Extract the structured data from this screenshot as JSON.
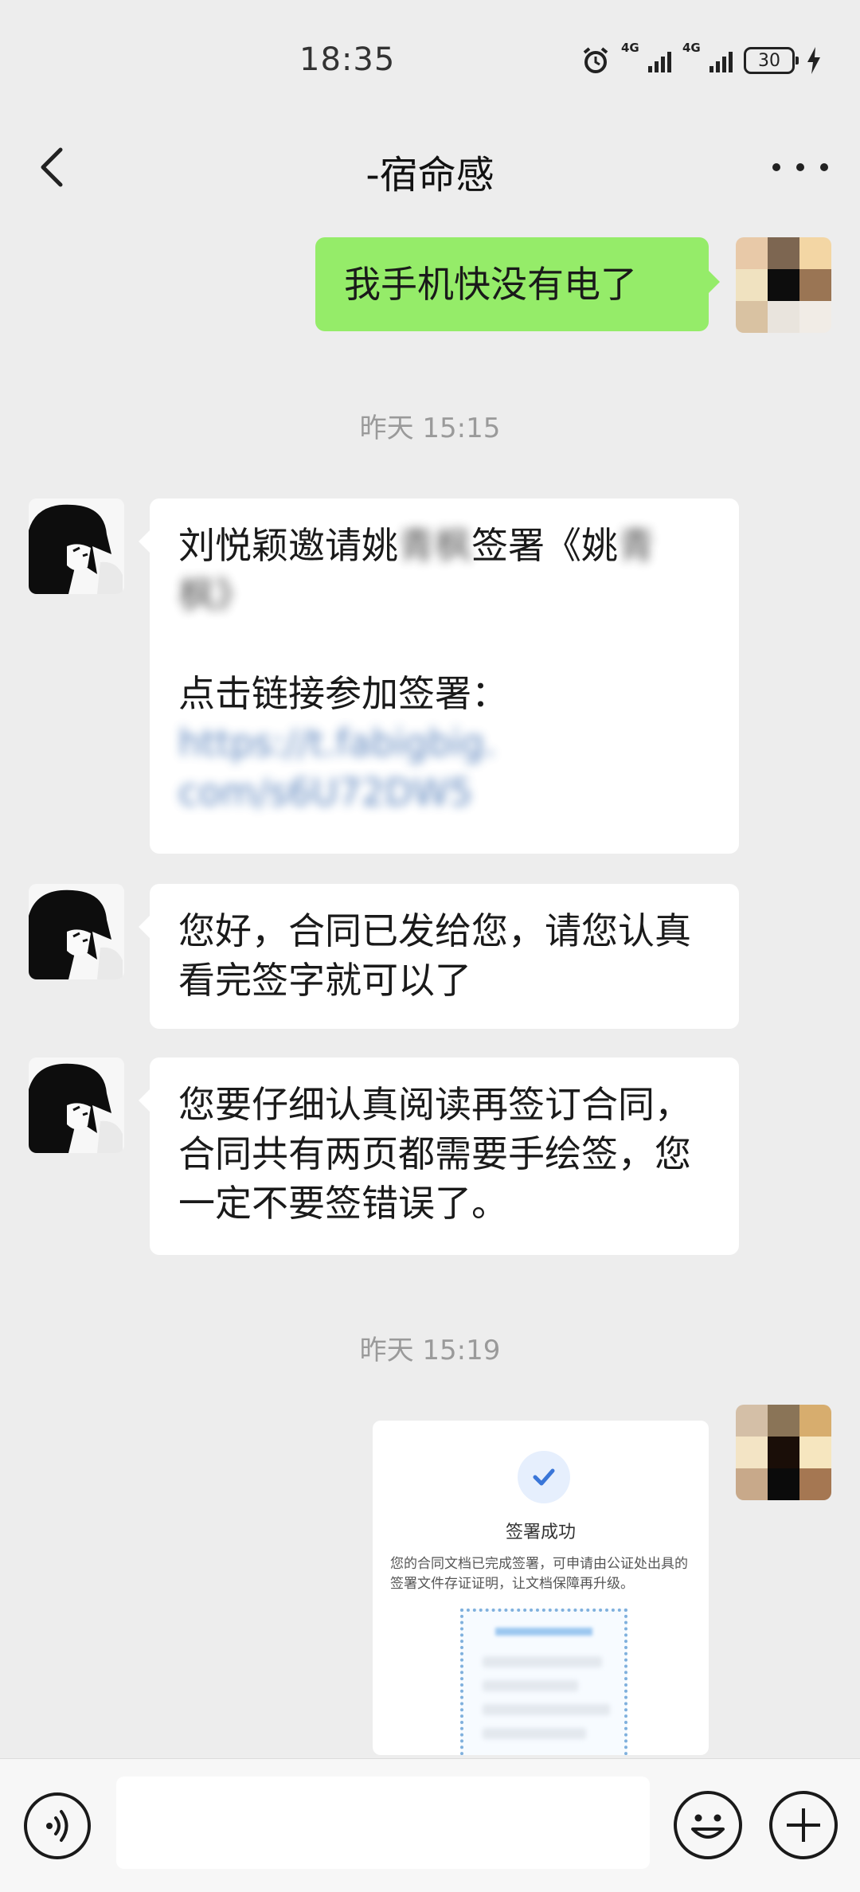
{
  "status_bar": {
    "time": "18:35",
    "network_1": "4G",
    "network_2": "4G",
    "battery": "30"
  },
  "nav": {
    "title": "-宿命感"
  },
  "messages": {
    "m1": {
      "text": "我手机快没有电了"
    },
    "ts1": "昨天 15:15",
    "m2": {
      "line1_visible": "刘悦颖邀请姚",
      "line1_blurred": "青枫",
      "line1_visible2": "签署《姚",
      "line1_blurred2": "青",
      "line2_blurred": "枫》",
      "line3": "点击链接参加签署：",
      "link1": "https://t.fabigbig.",
      "link2": "com/s6U72DW5"
    },
    "m3": {
      "text": "您好，合同已发给您，请您认真看完签字就可以了"
    },
    "m4": {
      "text": "您要仔细认真阅读再签订合同，合同共有两页都需要手绘签，您一定不要签错误了。"
    },
    "ts2": "昨天 15:19",
    "m5": {
      "title": "签署成功",
      "desc": "您的合同文档已完成签署，可申请由公证处出具的签署文件存证证明，让文档保障再升级。"
    }
  },
  "colors": {
    "background": "#ededed",
    "bubble_green": "#95ec69",
    "bubble_white": "#ffffff",
    "accent_blue": "#3a76d8"
  },
  "icons": {
    "back": "chevron-left-icon",
    "more": "more-dots-icon",
    "voice": "voice-icon",
    "emoji": "emoji-icon",
    "plus": "plus-icon",
    "check": "check-icon"
  }
}
